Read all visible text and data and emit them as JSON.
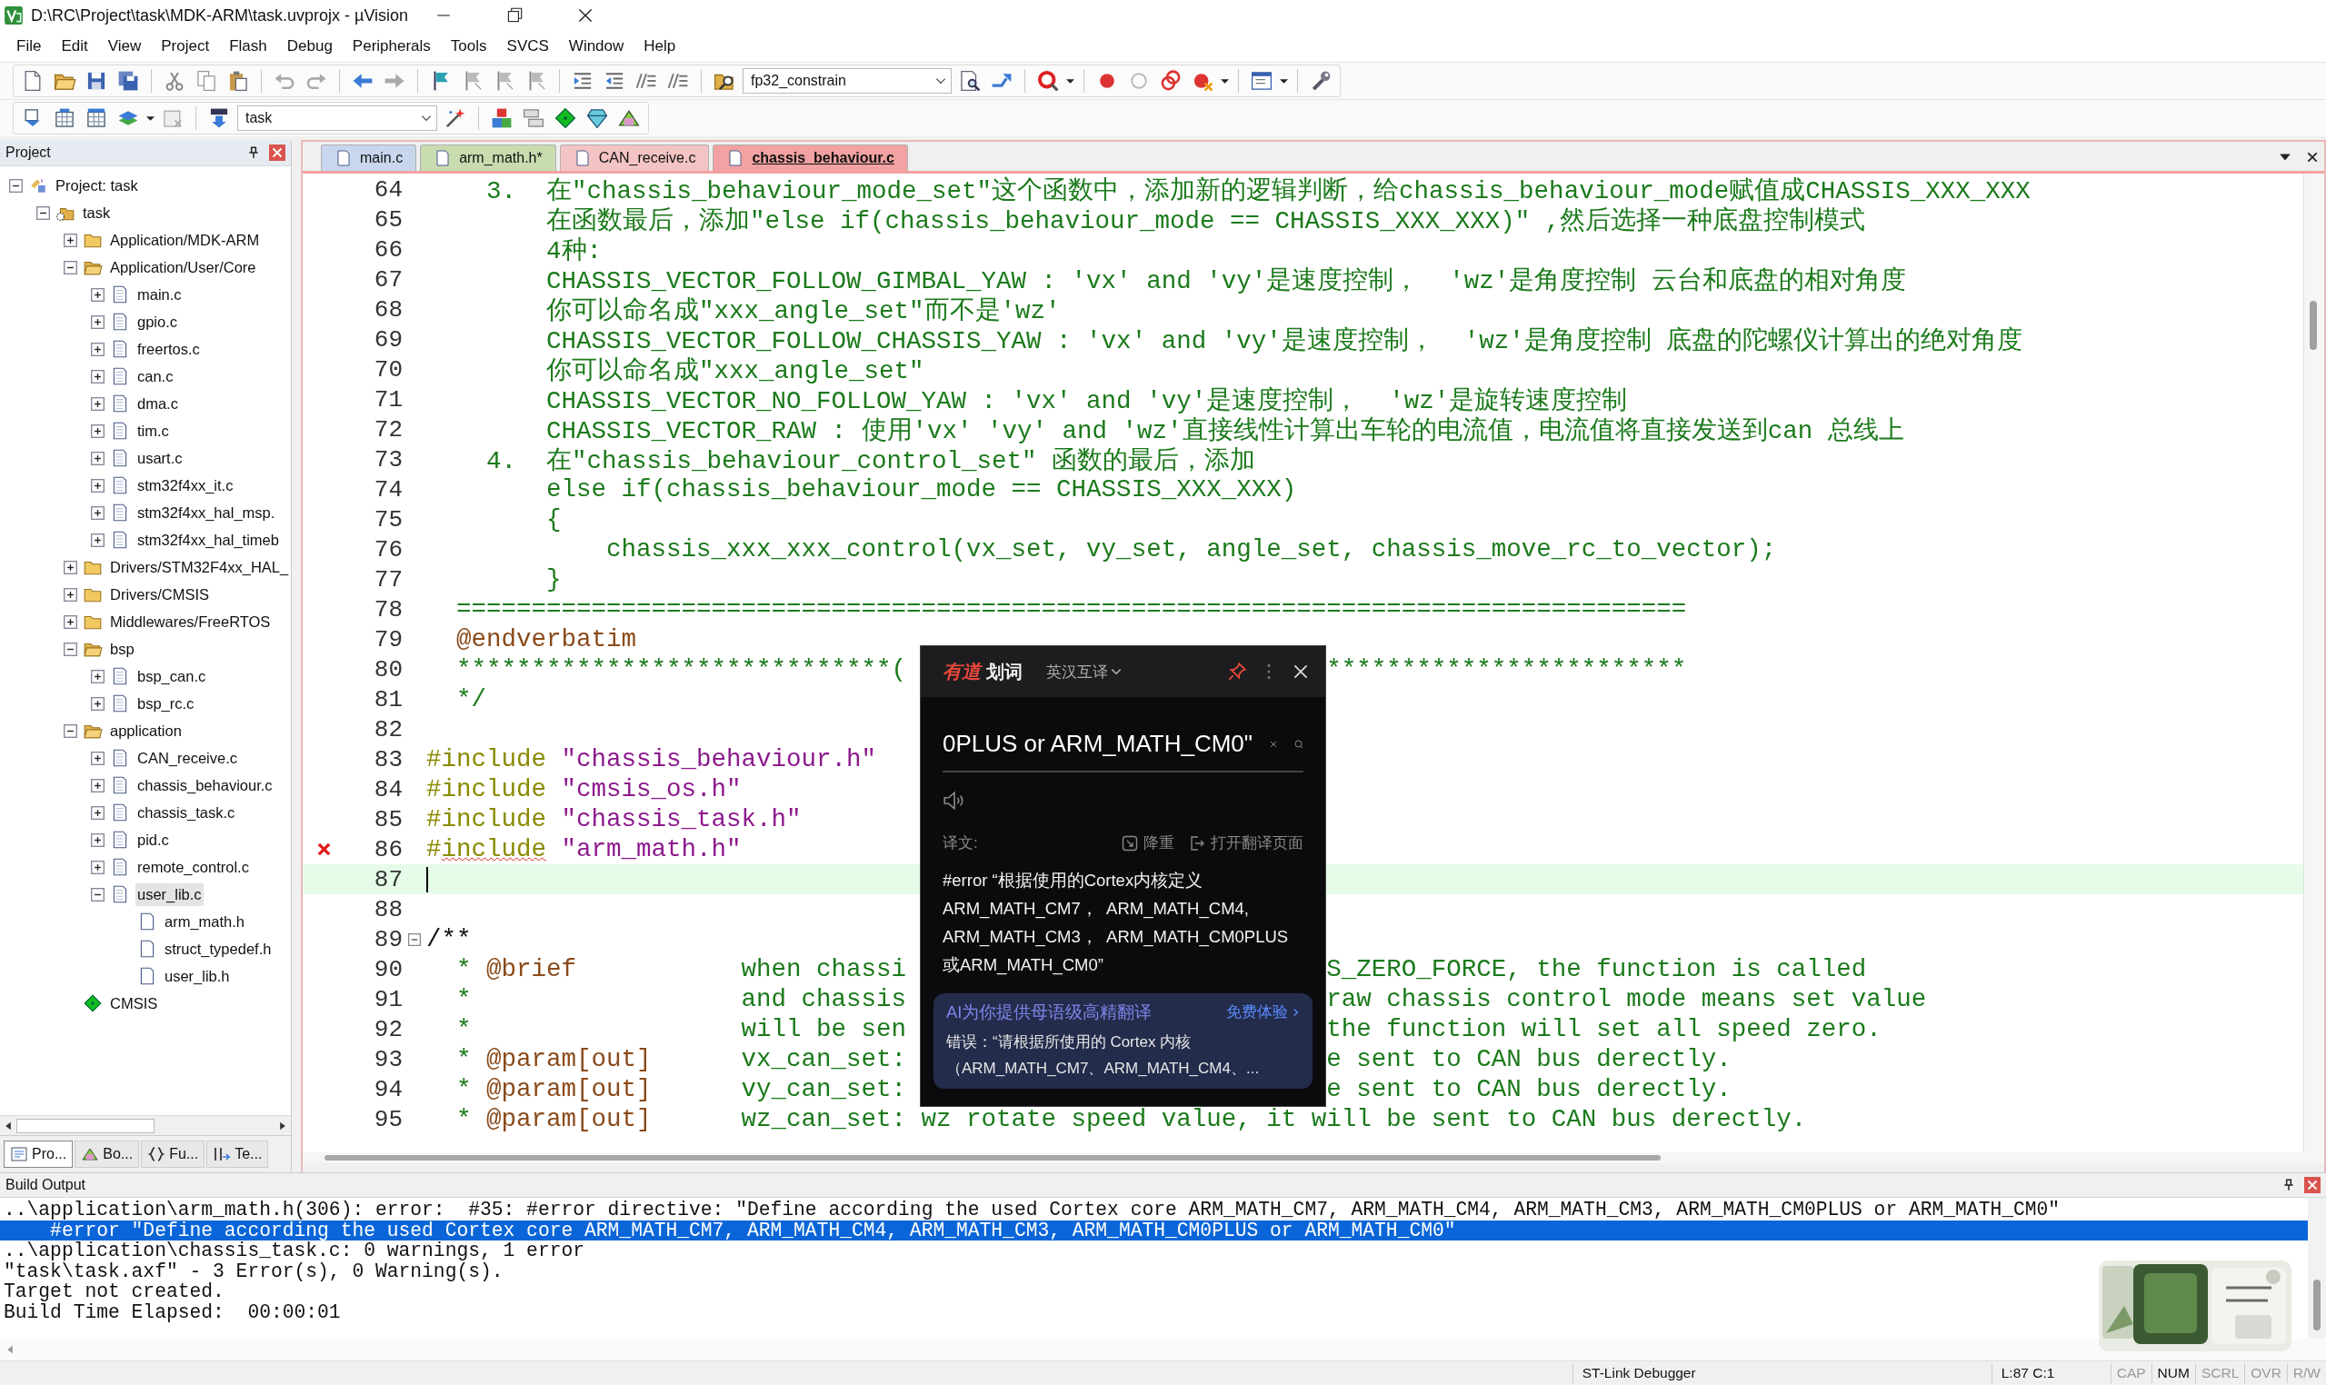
{
  "window": {
    "title": "D:\\RC\\Project\\task\\MDK-ARM\\task.uvprojx - µVision"
  },
  "menu": [
    "File",
    "Edit",
    "View",
    "Project",
    "Flash",
    "Debug",
    "Peripherals",
    "Tools",
    "SVCS",
    "Window",
    "Help"
  ],
  "toolbar": {
    "find_combo": "fp32_constrain",
    "target_combo": "task"
  },
  "project_panel": {
    "title": "Project",
    "tree": [
      {
        "label": "Project: task",
        "kind": "project",
        "expanded": true,
        "selected": false,
        "children": [
          {
            "label": "task",
            "kind": "target",
            "expanded": true,
            "selected": false,
            "children": [
              {
                "label": "Application/MDK-ARM",
                "kind": "group",
                "expanded": false,
                "selected": false
              },
              {
                "label": "Application/User/Core",
                "kind": "group",
                "expanded": true,
                "selected": false,
                "children": [
                  {
                    "label": "main.c",
                    "kind": "file",
                    "expanded": false,
                    "selected": false
                  },
                  {
                    "label": "gpio.c",
                    "kind": "file",
                    "expanded": false,
                    "selected": false
                  },
                  {
                    "label": "freertos.c",
                    "kind": "file",
                    "expanded": false,
                    "selected": false
                  },
                  {
                    "label": "can.c",
                    "kind": "file",
                    "expanded": false,
                    "selected": false
                  },
                  {
                    "label": "dma.c",
                    "kind": "file",
                    "expanded": false,
                    "selected": false
                  },
                  {
                    "label": "tim.c",
                    "kind": "file",
                    "expanded": false,
                    "selected": false
                  },
                  {
                    "label": "usart.c",
                    "kind": "file",
                    "expanded": false,
                    "selected": false
                  },
                  {
                    "label": "stm32f4xx_it.c",
                    "kind": "file",
                    "expanded": false,
                    "selected": false
                  },
                  {
                    "label": "stm32f4xx_hal_msp.",
                    "kind": "file",
                    "expanded": false,
                    "selected": false
                  },
                  {
                    "label": "stm32f4xx_hal_timeb",
                    "kind": "file",
                    "expanded": false,
                    "selected": false
                  }
                ]
              },
              {
                "label": "Drivers/STM32F4xx_HAL_",
                "kind": "group",
                "expanded": false,
                "selected": false
              },
              {
                "label": "Drivers/CMSIS",
                "kind": "group",
                "expanded": false,
                "selected": false
              },
              {
                "label": "Middlewares/FreeRTOS",
                "kind": "group",
                "expanded": false,
                "selected": false
              },
              {
                "label": "bsp",
                "kind": "group",
                "expanded": true,
                "selected": false,
                "children": [
                  {
                    "label": "bsp_can.c",
                    "kind": "file",
                    "expanded": false,
                    "selected": false
                  },
                  {
                    "label": "bsp_rc.c",
                    "kind": "file",
                    "expanded": false,
                    "selected": false
                  }
                ]
              },
              {
                "label": "application",
                "kind": "group",
                "expanded": true,
                "selected": false,
                "children": [
                  {
                    "label": "CAN_receive.c",
                    "kind": "file",
                    "expanded": false,
                    "selected": false
                  },
                  {
                    "label": "chassis_behaviour.c",
                    "kind": "file",
                    "expanded": false,
                    "selected": false
                  },
                  {
                    "label": "chassis_task.c",
                    "kind": "file",
                    "expanded": false,
                    "selected": false
                  },
                  {
                    "label": "pid.c",
                    "kind": "file",
                    "expanded": false,
                    "selected": false
                  },
                  {
                    "label": "remote_control.c",
                    "kind": "file",
                    "expanded": false,
                    "selected": false
                  },
                  {
                    "label": "user_lib.c",
                    "kind": "file",
                    "expanded": true,
                    "selected": true,
                    "children": [
                      {
                        "label": "arm_math.h",
                        "kind": "header",
                        "selected": false
                      },
                      {
                        "label": "struct_typedef.h",
                        "kind": "header",
                        "selected": false
                      },
                      {
                        "label": "user_lib.h",
                        "kind": "header",
                        "selected": false
                      }
                    ]
                  }
                ]
              },
              {
                "label": "CMSIS",
                "kind": "component",
                "selected": false
              }
            ]
          }
        ]
      }
    ],
    "tabs": [
      {
        "label": "Pro...",
        "kind": "project",
        "selected": true
      },
      {
        "label": "Bo...",
        "kind": "books",
        "selected": false
      },
      {
        "label": "Fu...",
        "kind": "functions",
        "selected": false
      },
      {
        "label": "Te...",
        "kind": "templates",
        "selected": false
      }
    ]
  },
  "editor": {
    "tabs": [
      {
        "label": "main.c",
        "color": "#c8d6ee",
        "selected": false
      },
      {
        "label": "arm_math.h*",
        "color": "#c8dcb0",
        "selected": false
      },
      {
        "label": "CAN_receive.c",
        "color": "#f4c4c4",
        "selected": false
      },
      {
        "label": "chassis_behaviour.c",
        "color": "#f2a2a2",
        "selected": true
      }
    ],
    "lines": [
      {
        "n": "64",
        "kind": "normal",
        "tokens": [
          {
            "kind": "comment",
            "text": "    3.  在\"chassis_behaviour_mode_set\"这个函数中，添加新的逻辑判断，给chassis_behaviour_mode赋值成CHASSIS_XXX_XXX"
          }
        ]
      },
      {
        "n": "65",
        "kind": "normal",
        "tokens": [
          {
            "kind": "comment",
            "text": "        在函数最后，添加\"else if(chassis_behaviour_mode == CHASSIS_XXX_XXX)\" ,然后选择一种底盘控制模式"
          }
        ]
      },
      {
        "n": "66",
        "kind": "normal",
        "tokens": [
          {
            "kind": "comment",
            "text": "        4种:"
          }
        ]
      },
      {
        "n": "67",
        "kind": "normal",
        "tokens": [
          {
            "kind": "comment",
            "text": "        CHASSIS_VECTOR_FOLLOW_GIMBAL_YAW : 'vx' and 'vy'是速度控制，  'wz'是角度控制 云台和底盘的相对角度"
          }
        ]
      },
      {
        "n": "68",
        "kind": "normal",
        "tokens": [
          {
            "kind": "comment",
            "text": "        你可以命名成\"xxx_angle_set\"而不是'wz'"
          }
        ]
      },
      {
        "n": "69",
        "kind": "normal",
        "tokens": [
          {
            "kind": "comment",
            "text": "        CHASSIS_VECTOR_FOLLOW_CHASSIS_YAW : 'vx' and 'vy'是速度控制，  'wz'是角度控制 底盘的陀螺仪计算出的绝对角度"
          }
        ]
      },
      {
        "n": "70",
        "kind": "normal",
        "tokens": [
          {
            "kind": "comment",
            "text": "        你可以命名成\"xxx_angle_set\""
          }
        ]
      },
      {
        "n": "71",
        "kind": "normal",
        "tokens": [
          {
            "kind": "comment",
            "text": "        CHASSIS_VECTOR_NO_FOLLOW_YAW : 'vx' and 'vy'是速度控制，  'wz'是旋转速度控制"
          }
        ]
      },
      {
        "n": "72",
        "kind": "normal",
        "tokens": [
          {
            "kind": "comment",
            "text": "        CHASSIS_VECTOR_RAW : 使用'vx' 'vy' and 'wz'直接线性计算出车轮的电流值，电流值将直接发送到can 总线上"
          }
        ]
      },
      {
        "n": "73",
        "kind": "normal",
        "tokens": [
          {
            "kind": "comment",
            "text": "    4.  在\"chassis_behaviour_control_set\" 函数的最后，添加"
          }
        ]
      },
      {
        "n": "74",
        "kind": "normal",
        "tokens": [
          {
            "kind": "comment",
            "text": "        else if(chassis_behaviour_mode == CHASSIS_XXX_XXX)"
          }
        ]
      },
      {
        "n": "75",
        "kind": "normal",
        "tokens": [
          {
            "kind": "comment",
            "text": "        {"
          }
        ]
      },
      {
        "n": "76",
        "kind": "normal",
        "tokens": [
          {
            "kind": "comment",
            "text": "            chassis_xxx_xxx_control(vx_set, vy_set, angle_set, chassis_move_rc_to_vector);"
          }
        ]
      },
      {
        "n": "77",
        "kind": "normal",
        "tokens": [
          {
            "kind": "comment",
            "text": "        }"
          }
        ]
      },
      {
        "n": "78",
        "kind": "normal",
        "tokens": [
          {
            "kind": "comment",
            "text": "  =================================================================================="
          }
        ]
      },
      {
        "n": "79",
        "kind": "normal",
        "tokens": [
          {
            "kind": "doctag",
            "text": "  @endverbatim"
          }
        ]
      },
      {
        "n": "80",
        "kind": "normal",
        "tokens": [
          {
            "kind": "comment",
            "text": "  *****************************("
          }
        ],
        "after": "************************"
      },
      {
        "n": "81",
        "kind": "normal",
        "tokens": [
          {
            "kind": "comment",
            "text": "  */"
          }
        ]
      },
      {
        "n": "82",
        "kind": "normal"
      },
      {
        "n": "83",
        "kind": "normal",
        "tokens": [
          {
            "kind": "directive",
            "text": "#include"
          },
          {
            "kind": "string",
            "text": " \"chassis_behaviour.h\""
          }
        ]
      },
      {
        "n": "84",
        "kind": "normal",
        "tokens": [
          {
            "kind": "directive",
            "text": "#include"
          },
          {
            "kind": "string",
            "text": " \"cmsis_os.h\""
          }
        ]
      },
      {
        "n": "85",
        "kind": "normal",
        "tokens": [
          {
            "kind": "directive",
            "text": "#include"
          },
          {
            "kind": "string",
            "text": " \"chassis_task.h\""
          }
        ]
      },
      {
        "n": "86",
        "kind": "error",
        "tokens": [
          {
            "kind": "directive",
            "text": "#"
          },
          {
            "kind": "squiggle",
            "text": "include"
          },
          {
            "kind": "string",
            "text": " \"arm_math.h\""
          }
        ]
      },
      {
        "n": "87",
        "kind": "current"
      },
      {
        "n": "88",
        "kind": "normal"
      },
      {
        "n": "89",
        "kind": "fold",
        "tokens": [
          {
            "kind": "plain",
            "text": "/**"
          }
        ]
      },
      {
        "n": "90",
        "kind": "normal",
        "tokens": [
          {
            "kind": "comment",
            "text": "  * "
          },
          {
            "kind": "doctag",
            "text": "@brief"
          },
          {
            "kind": "comment",
            "text": "           when chassi"
          }
        ],
        "after": "S_ZERO_FORCE, the function is called"
      },
      {
        "n": "91",
        "kind": "normal",
        "tokens": [
          {
            "kind": "comment",
            "text": "  *                  and chassis"
          }
        ],
        "after": "raw chassis control mode means set value"
      },
      {
        "n": "92",
        "kind": "normal",
        "tokens": [
          {
            "kind": "comment",
            "text": "  *                  will be sen"
          }
        ],
        "after": "the function will set all speed zero."
      },
      {
        "n": "93",
        "kind": "normal",
        "tokens": [
          {
            "kind": "comment",
            "text": "  * "
          },
          {
            "kind": "doctag",
            "text": "@param[out]"
          },
          {
            "kind": "comment",
            "text": "      vx_can_set:"
          }
        ],
        "after": "e sent to CAN bus derectly."
      },
      {
        "n": "94",
        "kind": "normal",
        "tokens": [
          {
            "kind": "comment",
            "text": "  * "
          },
          {
            "kind": "doctag",
            "text": "@param[out]"
          },
          {
            "kind": "comment",
            "text": "      vy_can_set:"
          }
        ],
        "after": "e sent to CAN bus derectly."
      },
      {
        "n": "95",
        "kind": "normal",
        "tokens": [
          {
            "kind": "comment",
            "text": "  * "
          },
          {
            "kind": "doctag",
            "text": "@param[out]"
          },
          {
            "kind": "comment",
            "text": "      wz_can_set: wz rotate speed value, it will be sent to CAN bus derectly."
          }
        ]
      }
    ]
  },
  "popup": {
    "brand_mark": "有道",
    "brand": "划词",
    "mode": "英汉互译",
    "query": "0PLUS or ARM_MATH_CM0\"",
    "result_label": "译文:",
    "actions": [
      {
        "kind": "rewrite",
        "label": "降重"
      },
      {
        "kind": "open",
        "label": "打开翻译页面"
      }
    ],
    "translation": [
      "#error “根据使用的Cortex内核定义",
      "ARM_MATH_CM7，  ARM_MATH_CM4,",
      "ARM_MATH_CM3，  ARM_MATH_CM0PLUS",
      "或ARM_MATH_CM0”"
    ],
    "promo": {
      "title": "AI为你提供母语级高精翻译",
      "link": "免费体验",
      "lines": [
        "错误：“请根据所使用的 Cortex 内核",
        "（ARM_MATH_CM7、ARM_MATH_CM4、..."
      ]
    }
  },
  "output": {
    "title": "Build Output",
    "lines": [
      {
        "text": "..\\application\\arm_math.h(306): error:  #35: #error directive: \"Define according the used Cortex core ARM_MATH_CM7, ARM_MATH_CM4, ARM_MATH_CM3, ARM_MATH_CM0PLUS or ARM_MATH_CM0\"",
        "selected": false
      },
      {
        "text": "    #error \"Define according the used Cortex core ARM_MATH_CM7, ARM_MATH_CM4, ARM_MATH_CM3, ARM_MATH_CM0PLUS or ARM_MATH_CM0\"",
        "selected": true
      },
      {
        "text": "..\\application\\chassis_task.c: 0 warnings, 1 error",
        "selected": false
      },
      {
        "text": "\"task\\task.axf\" - 3 Error(s), 0 Warning(s).",
        "selected": false
      },
      {
        "text": "Target not created.",
        "selected": false
      },
      {
        "text": "Build Time Elapsed:  00:00:01",
        "selected": false
      }
    ]
  },
  "status": {
    "debugger": "ST-Link Debugger",
    "position": "L:87 C:1",
    "indicators": [
      {
        "label": "CAP",
        "on": false
      },
      {
        "label": "NUM",
        "on": true
      },
      {
        "label": "SCRL",
        "on": false
      },
      {
        "label": "OVR",
        "on": false
      },
      {
        "label": "R/W",
        "on": false
      }
    ]
  }
}
